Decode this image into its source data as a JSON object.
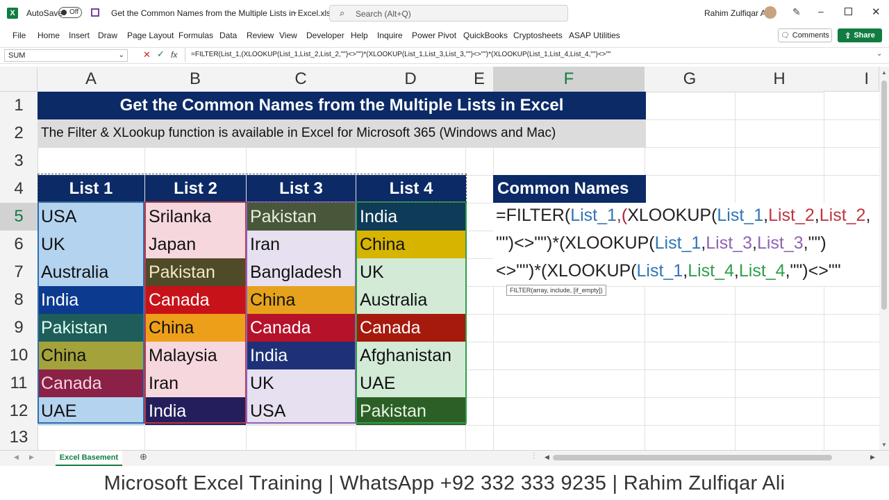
{
  "titlebar": {
    "autosave_label": "AutoSave",
    "autosave_state": "Off",
    "file_name": "Get the Common Names from the Multiple Lists in Excel.xlsx",
    "search_placeholder": "Search (Alt+Q)",
    "user_name": "Rahim Zulfiqar Ali"
  },
  "ribbon": {
    "tabs": [
      "File",
      "Home",
      "Insert",
      "Draw",
      "Page Layout",
      "Formulas",
      "Data",
      "Review",
      "View",
      "Developer",
      "Help",
      "Inquire",
      "Power Pivot",
      "QuickBooks",
      "Cryptosheets",
      "ASAP Utilities"
    ],
    "comments_label": "Comments",
    "share_label": "Share"
  },
  "formula_bar": {
    "name_box": "SUM",
    "fx": "fx",
    "formula": "=FILTER(List_1,(XLOOKUP(List_1,List_2,List_2,\"\")<>\"\")*(XLOOKUP(List_1,List_3,List_3,\"\")<>\"\")*(XLOOKUP(List_1,List_4,List_4,\"\")<>\"\""
  },
  "columns": [
    "A",
    "B",
    "C",
    "D",
    "E",
    "F",
    "G",
    "H",
    "I"
  ],
  "rows": [
    "1",
    "2",
    "3",
    "4",
    "5",
    "6",
    "7",
    "8",
    "9",
    "10",
    "11",
    "12",
    "13"
  ],
  "sheet": {
    "title": "Get the Common Names from the Multiple Lists in Excel",
    "subtitle": "The Filter & XLookup function is available in Excel for Microsoft 365 (Windows and Mac)",
    "list_headers": [
      "List 1",
      "List 2",
      "List 3",
      "List 4"
    ],
    "list1": [
      "USA",
      "UK",
      "Australia",
      "India",
      "Pakistan",
      "China",
      "Canada",
      "UAE"
    ],
    "list2": [
      "Srilanka",
      "Japan",
      "Pakistan",
      "Canada",
      "China",
      "Malaysia",
      "Iran",
      "India"
    ],
    "list3": [
      "Pakistan",
      "Iran",
      "Bangladesh",
      "China",
      "Canada",
      "India",
      "UK",
      "USA"
    ],
    "list4": [
      "India",
      "China",
      "UK",
      "Australia",
      "Canada",
      "Afghanistan",
      "UAE",
      "Pakistan"
    ],
    "common_header": "Common Names",
    "formula_line1": [
      "=FILTER(",
      "List_1",
      ",(",
      "XLOOKUP(",
      "List_1",
      ",",
      "List_2",
      ",",
      "List_2",
      ","
    ],
    "formula_line2": [
      "\"\")<>\"\")*(",
      "XLOOKUP(",
      "List_1",
      ",",
      "List_3",
      ",",
      "List_3",
      ",\"\")"
    ],
    "formula_line3": [
      "<>\"\")*(",
      "XLOOKUP(",
      "List_1",
      ",",
      "List_4",
      ",",
      "List_4",
      ",\"\")<>\"\""
    ],
    "tooltip": "FILTER(array, include, [if_empty])"
  },
  "sheet_tab": "Excel Basement",
  "footer": "Microsoft Excel Training | WhatsApp +92 332 333 9235 | Rahim Zulfiqar Ali",
  "colors": {
    "header_navy": "#0b2a66",
    "excel_green": "#107c41"
  }
}
